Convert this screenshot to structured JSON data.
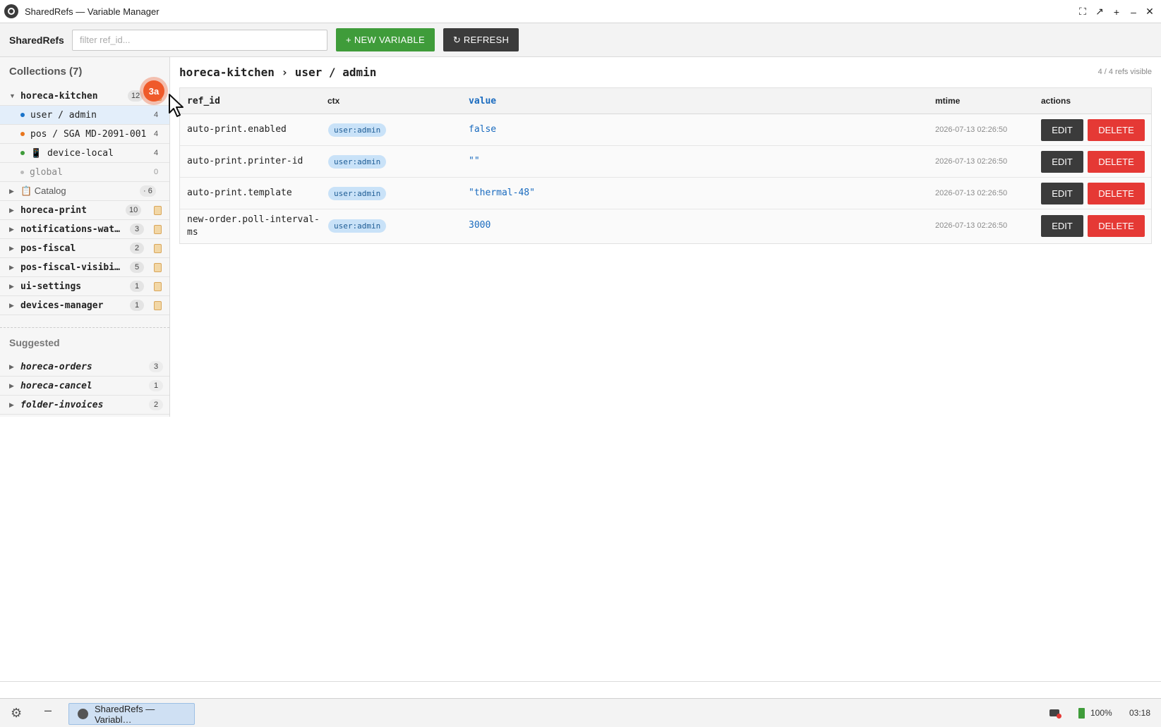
{
  "window": {
    "title": "SharedRefs — Variable Manager",
    "controls": [
      "⛶",
      "↗",
      "+",
      "–",
      "✕"
    ]
  },
  "toolbar": {
    "brand": "SharedRefs",
    "filter_placeholder": "filter ref_id...",
    "filter_value": "",
    "new_label": "+ NEW VARIABLE",
    "refresh_label": "↻ REFRESH"
  },
  "sidebar": {
    "collections_heading": "Collections (7)",
    "expanded": {
      "name": "horeca-kitchen",
      "count": "12",
      "children": [
        {
          "label": "user / admin",
          "count": "4",
          "dot": "#1a73c9"
        },
        {
          "label": "pos / SGA MD-2091-001",
          "count": "4",
          "dot": "#e8761d"
        },
        {
          "label": "📱 device-local",
          "count": "4",
          "dot": "#3f9c3a"
        },
        {
          "label": "global",
          "count": "0",
          "dot": "#bbbbbb"
        }
      ]
    },
    "catalog": {
      "label": "📋 Catalog",
      "count": "· 6"
    },
    "collections": [
      {
        "name": "horeca-print",
        "count": "10"
      },
      {
        "name": "notifications-watch…",
        "count": "3"
      },
      {
        "name": "pos-fiscal",
        "count": "2"
      },
      {
        "name": "pos-fiscal-visibili…",
        "count": "5"
      },
      {
        "name": "ui-settings",
        "count": "1"
      },
      {
        "name": "devices-manager",
        "count": "1"
      }
    ],
    "suggested_heading": "Suggested",
    "suggested": [
      {
        "name": "horeca-orders",
        "count": "3"
      },
      {
        "name": "horeca-cancel",
        "count": "1"
      },
      {
        "name": "folder-invoices",
        "count": "2"
      }
    ]
  },
  "main": {
    "breadcrumb": "horeca-kitchen › user / admin",
    "visible_count": "4 / 4 refs visible",
    "columns": [
      "ref_id",
      "ctx",
      "value",
      "mtime",
      "actions"
    ],
    "rows": [
      {
        "ref_id": "auto-print.enabled",
        "ctx": "user:admin",
        "value": "false",
        "mtime": "2026-07-13 02:26:50"
      },
      {
        "ref_id": "auto-print.printer-id",
        "ctx": "user:admin",
        "value": "\"\"",
        "mtime": "2026-07-13 02:26:50"
      },
      {
        "ref_id": "auto-print.template",
        "ctx": "user:admin",
        "value": "\"thermal-48\"",
        "mtime": "2026-07-13 02:26:50"
      },
      {
        "ref_id": "new-order.poll-interval-ms",
        "ref_id_line1": "new-order.poll-interval-",
        "ref_id_line2": "ms",
        "ctx": "user:admin",
        "value": "3000",
        "mtime": "2026-07-13 02:26:50"
      }
    ],
    "edit_label": "EDIT",
    "delete_label": "DELETE"
  },
  "taskbar": {
    "task_label": "SharedRefs — Variabl…",
    "battery": "100%",
    "clock": "03:18"
  },
  "overlay": {
    "step_marker": "3a"
  }
}
